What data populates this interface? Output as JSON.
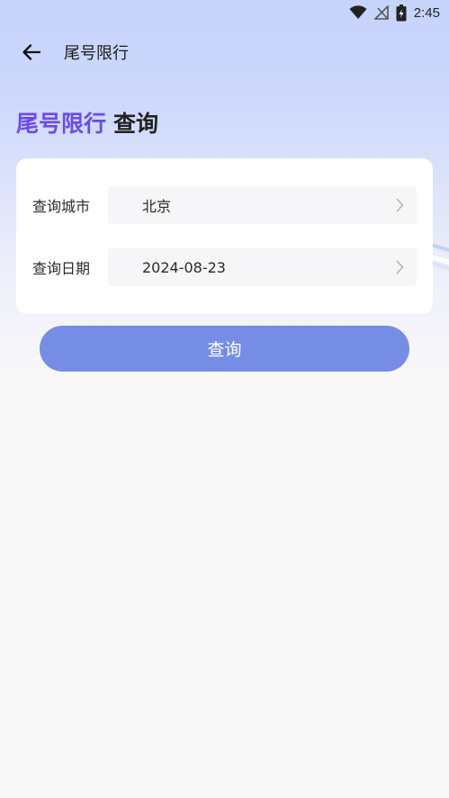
{
  "status_bar": {
    "time": "2:45",
    "icons": [
      "wifi-icon",
      "no-signal-icon",
      "battery-charging-icon"
    ]
  },
  "toolbar": {
    "back_icon": "arrow-left-icon",
    "title": "尾号限行"
  },
  "headline": {
    "accent": "尾号限行",
    "plain": "查询",
    "accent_color": "#6b49f0"
  },
  "form": {
    "city": {
      "label": "查询城市",
      "value": "北京"
    },
    "date": {
      "label": "查询日期",
      "value": "2024-08-23"
    }
  },
  "query_button": {
    "label": "查询",
    "color": "#768de6"
  }
}
